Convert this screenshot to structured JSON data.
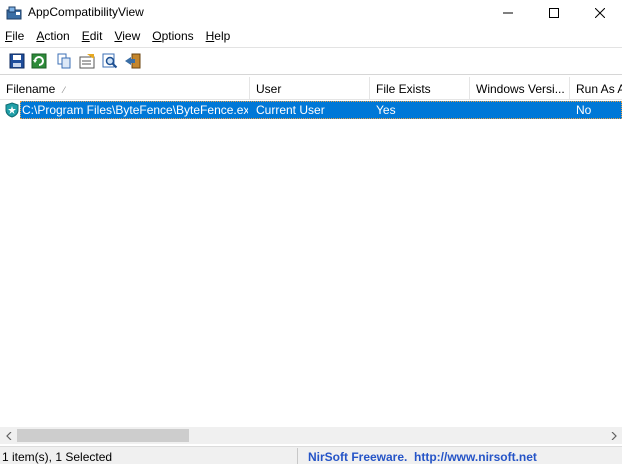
{
  "window": {
    "title": "AppCompatibilityView",
    "controls": {
      "minimize": "minimize-icon",
      "maximize": "maximize-icon",
      "close": "close-icon"
    }
  },
  "menu": {
    "items": [
      "File",
      "Action",
      "Edit",
      "View",
      "Options",
      "Help"
    ]
  },
  "toolbar": {
    "buttons": [
      "save-icon",
      "refresh-icon",
      "copy-icon",
      "properties-icon",
      "find-icon",
      "exit-icon"
    ]
  },
  "list": {
    "columns": [
      "Filename",
      "User",
      "File Exists",
      "Windows Versi...",
      "Run As A"
    ],
    "sort_indicator": "⁄",
    "rows": [
      {
        "filename": "C:\\Program Files\\ByteFence\\ByteFence.exe",
        "user": "Current User",
        "file_exists": "Yes",
        "windows_version": "",
        "run_as_admin": "No",
        "icon": "bytefence-shield-icon",
        "selected": true
      }
    ]
  },
  "status": {
    "left": "1 item(s), 1 Selected",
    "right": "NirSoft Freeware.  http://www.nirsoft.net"
  },
  "colors": {
    "selection": "#0078d7",
    "link": "#2554c7"
  }
}
